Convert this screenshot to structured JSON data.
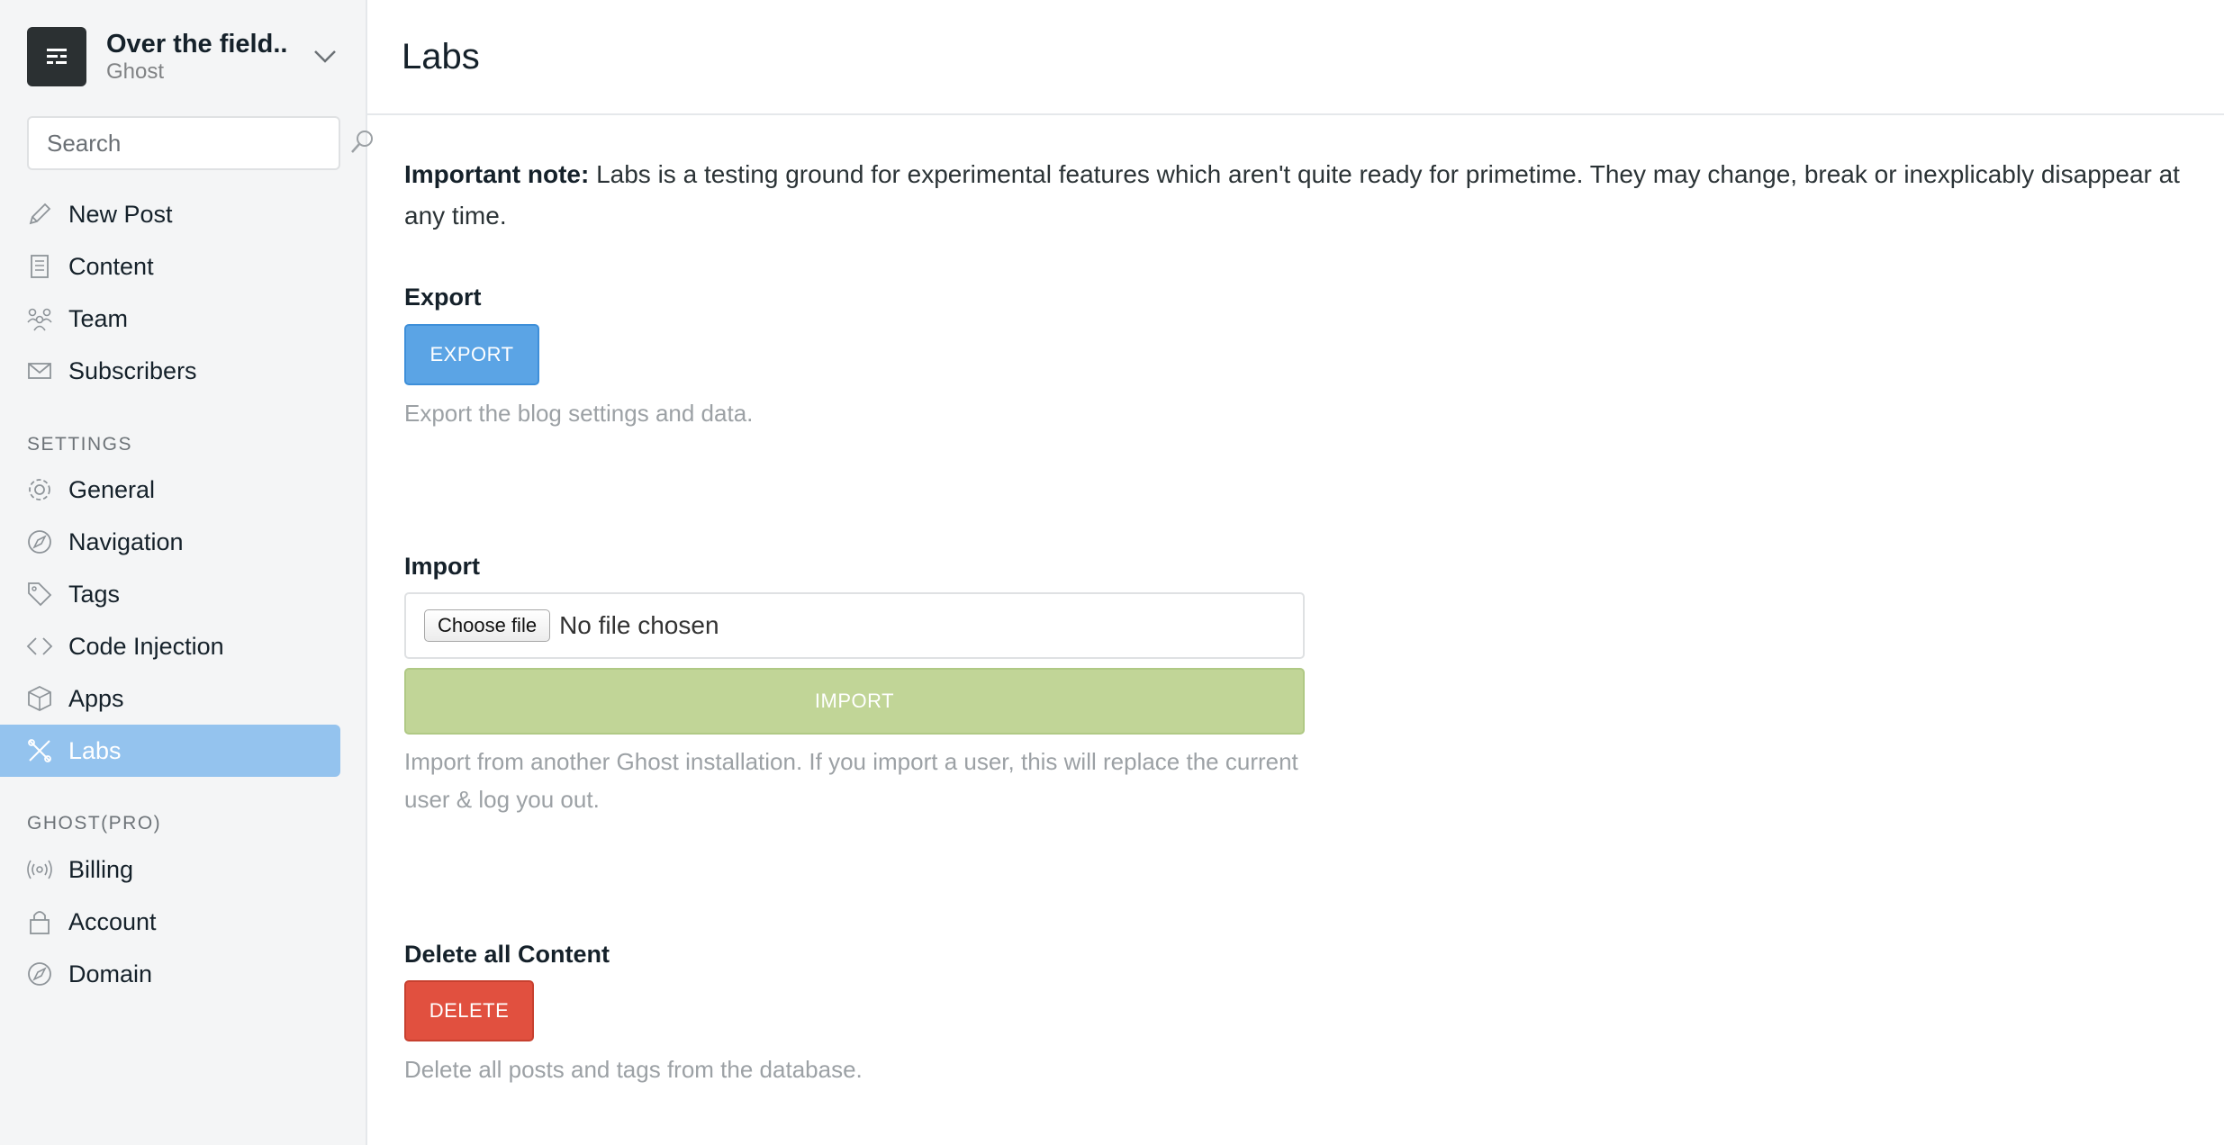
{
  "blog": {
    "title": "Over the field..",
    "subtitle": "Ghost"
  },
  "search": {
    "placeholder": "Search"
  },
  "nav": {
    "main": [
      {
        "label": "New Post",
        "icon": "pencil-icon"
      },
      {
        "label": "Content",
        "icon": "content-icon"
      },
      {
        "label": "Team",
        "icon": "team-icon"
      },
      {
        "label": "Subscribers",
        "icon": "mail-icon"
      }
    ],
    "settings_label": "SETTINGS",
    "settings": [
      {
        "label": "General",
        "icon": "gear-icon"
      },
      {
        "label": "Navigation",
        "icon": "compass-icon"
      },
      {
        "label": "Tags",
        "icon": "tag-icon"
      },
      {
        "label": "Code Injection",
        "icon": "code-icon"
      },
      {
        "label": "Apps",
        "icon": "box-icon"
      },
      {
        "label": "Labs",
        "icon": "labs-icon",
        "active": true
      }
    ],
    "pro_label": "GHOST(PRO)",
    "pro": [
      {
        "label": "Billing",
        "icon": "broadcast-icon"
      },
      {
        "label": "Account",
        "icon": "lock-icon"
      },
      {
        "label": "Domain",
        "icon": "compass-icon"
      }
    ]
  },
  "page": {
    "title": "Labs",
    "note_bold": "Important note:",
    "note_text": " Labs is a testing ground for experimental features which aren't quite ready for primetime. They may change, break or inexplicably disappear at any time."
  },
  "export": {
    "title": "Export",
    "button": "EXPORT",
    "help": "Export the blog settings and data."
  },
  "import": {
    "title": "Import",
    "file_button": "Choose file",
    "file_status": "No file chosen",
    "button": "IMPORT",
    "help": "Import from another Ghost installation. If you import a user, this will replace the current user & log you out."
  },
  "delete": {
    "title": "Delete all Content",
    "button": "DELETE",
    "help": "Delete all posts and tags from the database."
  },
  "colors": {
    "active_nav": "#94c3ee",
    "export_blue": "#5ba4e5",
    "import_green": "#c1d597",
    "delete_red": "#e1503f"
  }
}
